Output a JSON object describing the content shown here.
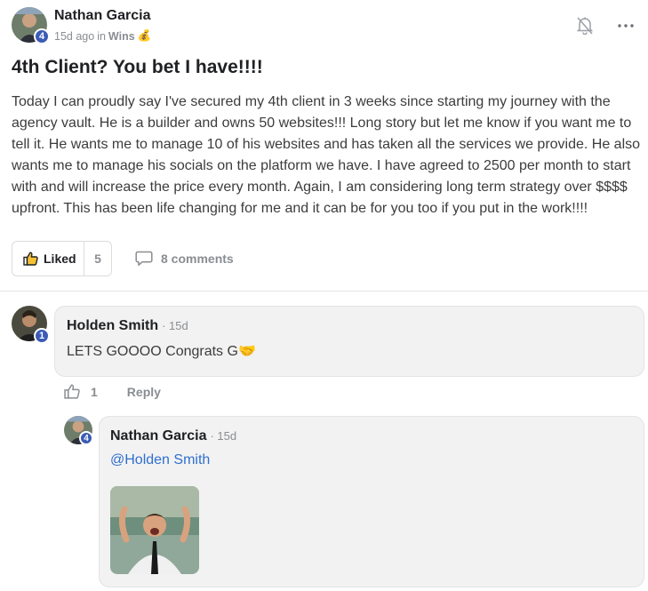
{
  "post": {
    "author": "Nathan Garcia",
    "author_level": "4",
    "time": "15d ago",
    "in_text": "in",
    "category": "Wins",
    "category_emoji": "💰",
    "title": "4th Client? You bet I have!!!!",
    "body": "Today I can proudly say I've secured my 4th client in 3 weeks since starting my journey with the agency vault. He is a builder and owns 50 websites!!! Long story but let me know if you want me to tell it. He wants me to manage 10 of his websites and has taken all the services we provide. He also wants me to manage his socials on the platform we have. I have agreed to 2500 per month to start with and will increase the price every month. Again, I am considering long term strategy over $$$$ upfront. This has been life changing for me and it can be for you too if you put in the work!!!!",
    "like_label": "Liked",
    "like_count": "5",
    "comments_label": "8 comments",
    "icons": {
      "bell": "bell-off-icon",
      "more": "more-icon"
    }
  },
  "comments": [
    {
      "author": "Holden Smith",
      "level": "1",
      "time": "· 15d",
      "text": "LETS GOOOO Congrats G",
      "emoji": "🤝",
      "like_count": "1",
      "reply_label": "Reply"
    },
    {
      "author": "Nathan Garcia",
      "level": "4",
      "time": "· 15d",
      "mention": "@Holden Smith"
    }
  ],
  "colors": {
    "accent": "#3b5bb5",
    "mention": "#2f6fd0",
    "muted": "#8a8d91"
  }
}
